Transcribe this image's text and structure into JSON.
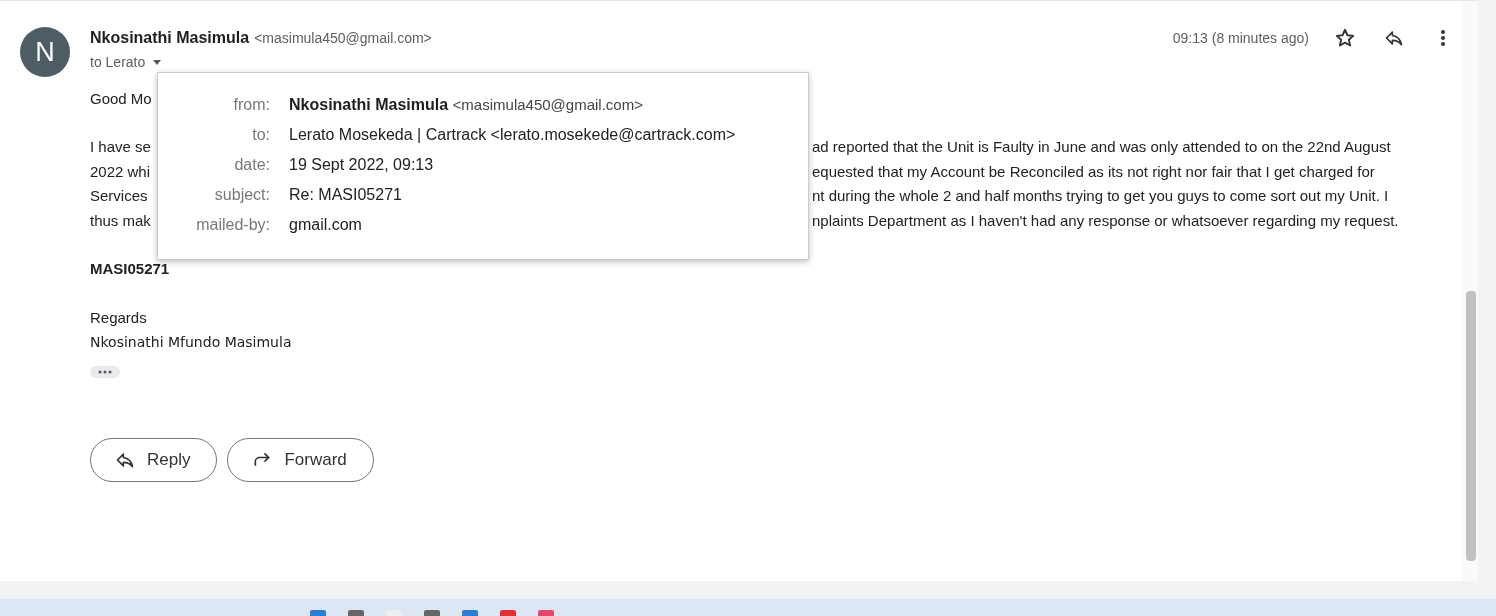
{
  "message": {
    "avatar_letter": "N",
    "sender_name": "Nkosinathi Masimula",
    "sender_email": "<masimula450@gmail.com>",
    "to_label": "to Lerato",
    "time": "09:13 (8 minutes ago)"
  },
  "body": {
    "greeting": "Good Mo",
    "lines": [
      {
        "left": "I have se",
        "right": "ad reported that the Unit is Faulty in June and was only attended to on the 22nd August"
      },
      {
        "left": "2022 whi",
        "right": "equested that my Account be Reconciled as its not right nor fair that I get charged for"
      },
      {
        "left": "Services",
        "right": "nt during the whole 2 and half months trying to get you guys to come sort out my Unit. I"
      },
      {
        "left": "thus mak",
        "right": "nplaints Department as I haven't had any response or whatsoever regarding my request."
      }
    ],
    "reference": "MASI05271",
    "closing": "Regards",
    "signature": "Nkosinathi Mfundo Masimula"
  },
  "actions": [
    {
      "kind": "reply",
      "label": "Reply"
    },
    {
      "kind": "forward",
      "label": "Forward"
    }
  ],
  "details_popup": {
    "rows": [
      {
        "label": "from:",
        "name": "Nkosinathi Masimula",
        "value": "<masimula450@gmail.com>"
      },
      {
        "label": "to:",
        "value": "Lerato Mosekeda | Cartrack <lerato.mosekede@cartrack.com>"
      },
      {
        "label": "date:",
        "value": "19 Sept 2022, 09:13"
      },
      {
        "label": "subject:",
        "value": "Re: MASI05271"
      },
      {
        "label": "mailed-by:",
        "value": "gmail.com"
      }
    ]
  }
}
